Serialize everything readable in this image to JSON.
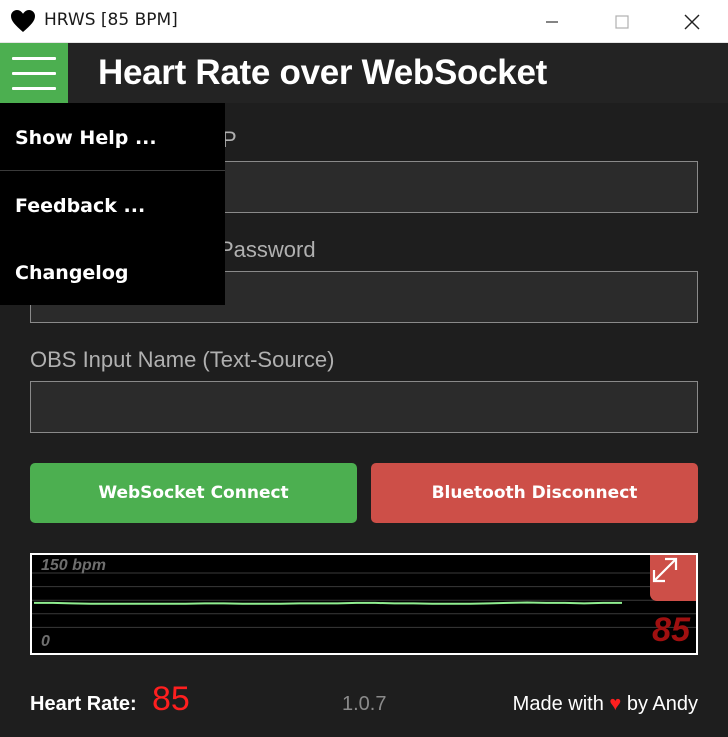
{
  "window": {
    "title": "HRWS [85 BPM]"
  },
  "header": {
    "title": "Heart Rate over WebSocket",
    "menu_icon": "hamburger-icon"
  },
  "form": {
    "fields": [
      {
        "label": "OBS WebSocket IP",
        "visible_label": "P",
        "value": ""
      },
      {
        "label": "OBS WebSocket Password",
        "visible_label": "Password",
        "value": ""
      },
      {
        "label": "OBS Input Name (Text-Source)",
        "visible_label": "OBS Input Name (Text-Source)",
        "value": ""
      }
    ]
  },
  "buttons": {
    "websocket": "WebSocket Connect",
    "bluetooth": "Bluetooth Disconnect"
  },
  "chart": {
    "max_label": "150 bpm",
    "min_label": "0",
    "current": "85",
    "expand_icon": "expand-icon"
  },
  "chart_data": {
    "type": "line",
    "ylim": [
      0,
      150
    ],
    "max_label": "150 bpm",
    "min_label": "0",
    "current_value": "85",
    "grid": true,
    "series": [
      {
        "values": [
          84,
          84,
          83,
          82,
          82,
          82,
          82,
          82,
          82,
          83,
          83,
          82,
          82,
          82,
          83,
          83,
          83,
          84,
          84,
          83,
          83,
          82,
          82,
          82,
          83,
          84,
          85,
          84,
          84,
          83,
          84,
          84
        ]
      }
    ],
    "colors": {
      "line": "#90ee90",
      "grid": "#3a3a3a"
    }
  },
  "footer": {
    "hr_label": "Heart Rate:",
    "hr_value": "85",
    "version": "1.0.7",
    "made_prefix": "Made with",
    "made_heart": "♥",
    "made_suffix": "by Andy"
  },
  "menu": {
    "items": [
      "Show Help ...",
      "Feedback ...",
      "Changelog"
    ]
  },
  "colors": {
    "accent_green": "#4caf50",
    "accent_red": "#cd4f48",
    "heart_red": "#ff1f1f"
  }
}
